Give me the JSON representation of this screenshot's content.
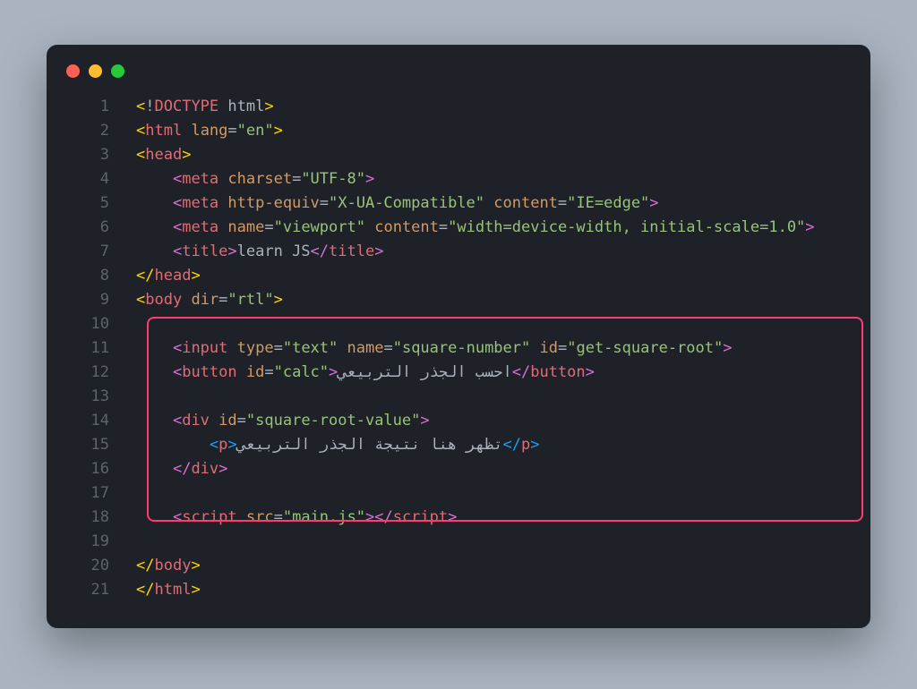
{
  "lines": {
    "l1": {
      "n": "1",
      "segs": [
        {
          "c": "bracket",
          "t": "<"
        },
        {
          "c": "punct",
          "t": "!"
        },
        {
          "c": "doctype-kw",
          "t": "DOCTYPE"
        },
        {
          "c": "punct",
          "t": " "
        },
        {
          "c": "doctype-name",
          "t": "html"
        },
        {
          "c": "bracket",
          "t": ">"
        }
      ]
    },
    "l2": {
      "n": "2",
      "segs": [
        {
          "c": "bracket",
          "t": "<"
        },
        {
          "c": "tag",
          "t": "html"
        },
        {
          "c": "punct",
          "t": " "
        },
        {
          "c": "attr",
          "t": "lang"
        },
        {
          "c": "punct",
          "t": "="
        },
        {
          "c": "str",
          "t": "\"en\""
        },
        {
          "c": "bracket",
          "t": ">"
        }
      ]
    },
    "l3": {
      "n": "3",
      "segs": [
        {
          "c": "bracket",
          "t": "<"
        },
        {
          "c": "tag",
          "t": "head"
        },
        {
          "c": "bracket",
          "t": ">"
        }
      ]
    },
    "l4": {
      "n": "4",
      "indent": "    ",
      "segs": [
        {
          "c": "bracket2",
          "t": "<"
        },
        {
          "c": "tag",
          "t": "meta"
        },
        {
          "c": "punct",
          "t": " "
        },
        {
          "c": "attr",
          "t": "charset"
        },
        {
          "c": "punct",
          "t": "="
        },
        {
          "c": "str",
          "t": "\"UTF-8\""
        },
        {
          "c": "bracket2",
          "t": ">"
        }
      ]
    },
    "l5": {
      "n": "5",
      "indent": "    ",
      "segs": [
        {
          "c": "bracket2",
          "t": "<"
        },
        {
          "c": "tag",
          "t": "meta"
        },
        {
          "c": "punct",
          "t": " "
        },
        {
          "c": "attr",
          "t": "http-equiv"
        },
        {
          "c": "punct",
          "t": "="
        },
        {
          "c": "str",
          "t": "\"X-UA-Compatible\""
        },
        {
          "c": "punct",
          "t": " "
        },
        {
          "c": "attr",
          "t": "content"
        },
        {
          "c": "punct",
          "t": "="
        },
        {
          "c": "str",
          "t": "\"IE=edge\""
        },
        {
          "c": "bracket2",
          "t": ">"
        }
      ]
    },
    "l6": {
      "n": "6",
      "indent": "    ",
      "segs": [
        {
          "c": "bracket2",
          "t": "<"
        },
        {
          "c": "tag",
          "t": "meta"
        },
        {
          "c": "punct",
          "t": " "
        },
        {
          "c": "attr",
          "t": "name"
        },
        {
          "c": "punct",
          "t": "="
        },
        {
          "c": "str",
          "t": "\"viewport\""
        },
        {
          "c": "punct",
          "t": " "
        },
        {
          "c": "attr",
          "t": "content"
        },
        {
          "c": "punct",
          "t": "="
        },
        {
          "c": "str",
          "t": "\"width=device-width, initial-scale=1.0\""
        },
        {
          "c": "bracket2",
          "t": ">"
        }
      ]
    },
    "l7": {
      "n": "7",
      "indent": "    ",
      "segs": [
        {
          "c": "bracket2",
          "t": "<"
        },
        {
          "c": "tag",
          "t": "title"
        },
        {
          "c": "bracket2",
          "t": ">"
        },
        {
          "c": "txt",
          "t": "learn JS"
        },
        {
          "c": "bracket2",
          "t": "</"
        },
        {
          "c": "tag",
          "t": "title"
        },
        {
          "c": "bracket2",
          "t": ">"
        }
      ]
    },
    "l8": {
      "n": "8",
      "segs": [
        {
          "c": "bracket",
          "t": "</"
        },
        {
          "c": "tag",
          "t": "head"
        },
        {
          "c": "bracket",
          "t": ">"
        }
      ]
    },
    "l9": {
      "n": "9",
      "segs": [
        {
          "c": "bracket",
          "t": "<"
        },
        {
          "c": "tag",
          "t": "body"
        },
        {
          "c": "punct",
          "t": " "
        },
        {
          "c": "attr",
          "t": "dir"
        },
        {
          "c": "punct",
          "t": "="
        },
        {
          "c": "str",
          "t": "\"rtl\""
        },
        {
          "c": "bracket",
          "t": ">"
        }
      ]
    },
    "l10": {
      "n": "10",
      "segs": []
    },
    "l11": {
      "n": "11",
      "indent": "    ",
      "segs": [
        {
          "c": "bracket2",
          "t": "<"
        },
        {
          "c": "tag",
          "t": "input"
        },
        {
          "c": "punct",
          "t": " "
        },
        {
          "c": "attr",
          "t": "type"
        },
        {
          "c": "punct",
          "t": "="
        },
        {
          "c": "str",
          "t": "\"text\""
        },
        {
          "c": "punct",
          "t": " "
        },
        {
          "c": "attr",
          "t": "name"
        },
        {
          "c": "punct",
          "t": "="
        },
        {
          "c": "str",
          "t": "\"square-number\""
        },
        {
          "c": "punct",
          "t": " "
        },
        {
          "c": "attr",
          "t": "id"
        },
        {
          "c": "punct",
          "t": "="
        },
        {
          "c": "str",
          "t": "\"get-square-root\""
        },
        {
          "c": "bracket2",
          "t": ">"
        }
      ]
    },
    "l12": {
      "n": "12",
      "indent": "    ",
      "segs": [
        {
          "c": "bracket2",
          "t": "<"
        },
        {
          "c": "tag",
          "t": "button"
        },
        {
          "c": "punct",
          "t": " "
        },
        {
          "c": "attr",
          "t": "id"
        },
        {
          "c": "punct",
          "t": "="
        },
        {
          "c": "str",
          "t": "\"calc\""
        },
        {
          "c": "bracket2",
          "t": ">"
        },
        {
          "c": "txt",
          "t": "احسب الجذر التربيعي"
        },
        {
          "c": "bracket2",
          "t": "</"
        },
        {
          "c": "tag",
          "t": "button"
        },
        {
          "c": "bracket2",
          "t": ">"
        }
      ]
    },
    "l13": {
      "n": "13",
      "segs": []
    },
    "l14": {
      "n": "14",
      "indent": "    ",
      "segs": [
        {
          "c": "bracket2",
          "t": "<"
        },
        {
          "c": "tag",
          "t": "div"
        },
        {
          "c": "punct",
          "t": " "
        },
        {
          "c": "attr",
          "t": "id"
        },
        {
          "c": "punct",
          "t": "="
        },
        {
          "c": "str",
          "t": "\"square-root-value\""
        },
        {
          "c": "bracket2",
          "t": ">"
        }
      ]
    },
    "l15": {
      "n": "15",
      "indent": "        ",
      "segs": [
        {
          "c": "bracket3",
          "t": "<"
        },
        {
          "c": "tag",
          "t": "p"
        },
        {
          "c": "bracket3",
          "t": ">"
        },
        {
          "c": "txt",
          "t": "تظهر هنا نتيجة الجذر التربيعي"
        },
        {
          "c": "bracket3",
          "t": "</"
        },
        {
          "c": "tag",
          "t": "p"
        },
        {
          "c": "bracket3",
          "t": ">"
        }
      ]
    },
    "l16": {
      "n": "16",
      "indent": "    ",
      "segs": [
        {
          "c": "bracket2",
          "t": "</"
        },
        {
          "c": "tag",
          "t": "div"
        },
        {
          "c": "bracket2",
          "t": ">"
        }
      ]
    },
    "l17": {
      "n": "17",
      "segs": []
    },
    "l18": {
      "n": "18",
      "indent": "    ",
      "segs": [
        {
          "c": "bracket2",
          "t": "<"
        },
        {
          "c": "tag",
          "t": "script"
        },
        {
          "c": "punct",
          "t": " "
        },
        {
          "c": "attr",
          "t": "src"
        },
        {
          "c": "punct",
          "t": "="
        },
        {
          "c": "str",
          "t": "\"main.js\""
        },
        {
          "c": "bracket2",
          "t": ">"
        },
        {
          "c": "bracket2",
          "t": "</"
        },
        {
          "c": "tag",
          "t": "script"
        },
        {
          "c": "bracket2",
          "t": ">"
        }
      ]
    },
    "l19": {
      "n": "19",
      "segs": []
    },
    "l20": {
      "n": "20",
      "segs": [
        {
          "c": "bracket",
          "t": "</"
        },
        {
          "c": "tag",
          "t": "body"
        },
        {
          "c": "bracket",
          "t": ">"
        }
      ]
    },
    "l21": {
      "n": "21",
      "segs": [
        {
          "c": "bracket",
          "t": "</"
        },
        {
          "c": "tag",
          "t": "html"
        },
        {
          "c": "bracket",
          "t": ">"
        }
      ]
    }
  },
  "lineOrder": [
    "l1",
    "l2",
    "l3",
    "l4",
    "l5",
    "l6",
    "l7",
    "l8",
    "l9",
    "l10",
    "l11",
    "l12",
    "l13",
    "l14",
    "l15",
    "l16",
    "l17",
    "l18",
    "l19",
    "l20",
    "l21"
  ]
}
